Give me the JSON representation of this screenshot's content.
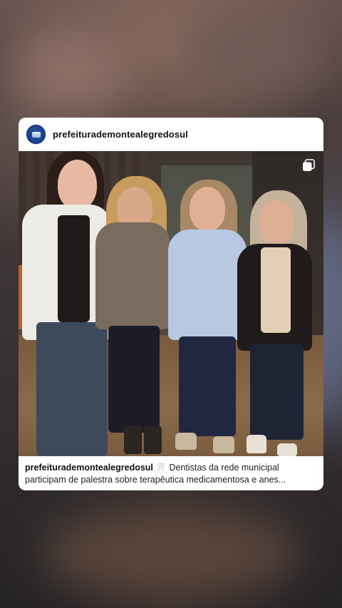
{
  "post": {
    "username": "prefeiturademontealegredosul",
    "caption_user": "prefeiturademontealegredosul",
    "caption_emoji": "🦷",
    "caption_text": "Dentistas da rede municipal participam de palestra sobre terapêutica medicamentosa e anes...",
    "media_type": "carousel",
    "multi_media_icon": "multiple-photos-icon",
    "avatar_icon": "profile-avatar",
    "colors": {
      "card_background": "#ffffff",
      "avatar_blue": "#18408a"
    }
  }
}
